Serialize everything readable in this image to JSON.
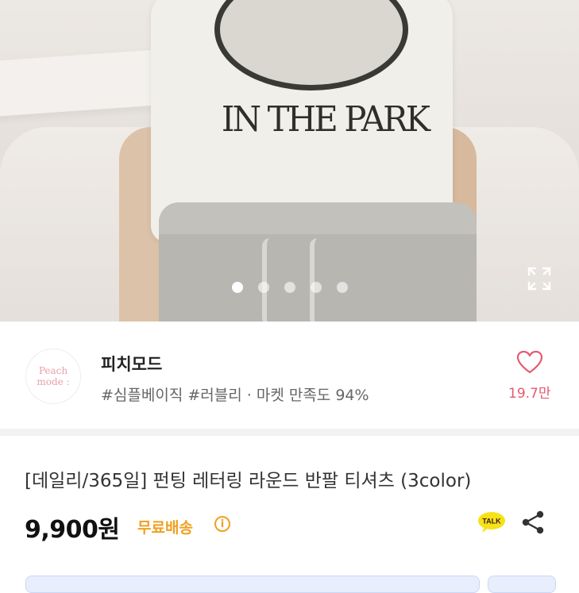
{
  "gallery": {
    "shirt_print_text": "IN THE PARK",
    "slide_count": 5,
    "active_slide": 1
  },
  "shop": {
    "logo_line1": "Peach",
    "logo_line2": "mode :",
    "name": "피치모드",
    "tags": "#심플베이직 #러블리 · 마켓 만족도 94%",
    "likes": "19.7만"
  },
  "product": {
    "title": "[데일리/365일] 펀팅 레터링 라운드 반팔 티셔츠 (3color)",
    "price": "9,900원",
    "shipping": "무료배송",
    "info_symbol": "i",
    "talk_label": "TALK"
  },
  "colors": {
    "accent_pink": "#e55a71",
    "shipping_orange": "#f0a020",
    "kakao_yellow": "#f7e117"
  },
  "icons": {
    "expand": "expand-icon",
    "heart": "heart-icon",
    "talk": "kakao-talk-icon",
    "share": "share-icon"
  }
}
